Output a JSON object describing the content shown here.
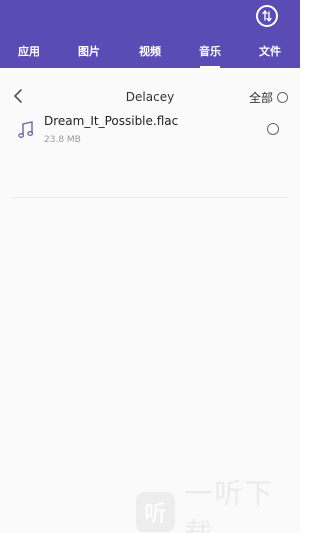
{
  "header": {
    "background": "#5b4bb4",
    "transfer_icon": "transfer-arrows-icon",
    "tabs": [
      {
        "label": "应用"
      },
      {
        "label": "图片"
      },
      {
        "label": "视频"
      },
      {
        "label": "音乐",
        "active": true
      },
      {
        "label": "文件"
      }
    ]
  },
  "pathbar": {
    "back_icon": "chevron-left-icon",
    "title": "Delacey",
    "select_all_label": "全部"
  },
  "files": [
    {
      "name": "Dream_It_Possible.flac",
      "size": "23.8 MB",
      "icon": "music-note-icon",
      "selected": false
    }
  ],
  "watermark": {
    "logo_char": "听",
    "text": "一听下载"
  }
}
